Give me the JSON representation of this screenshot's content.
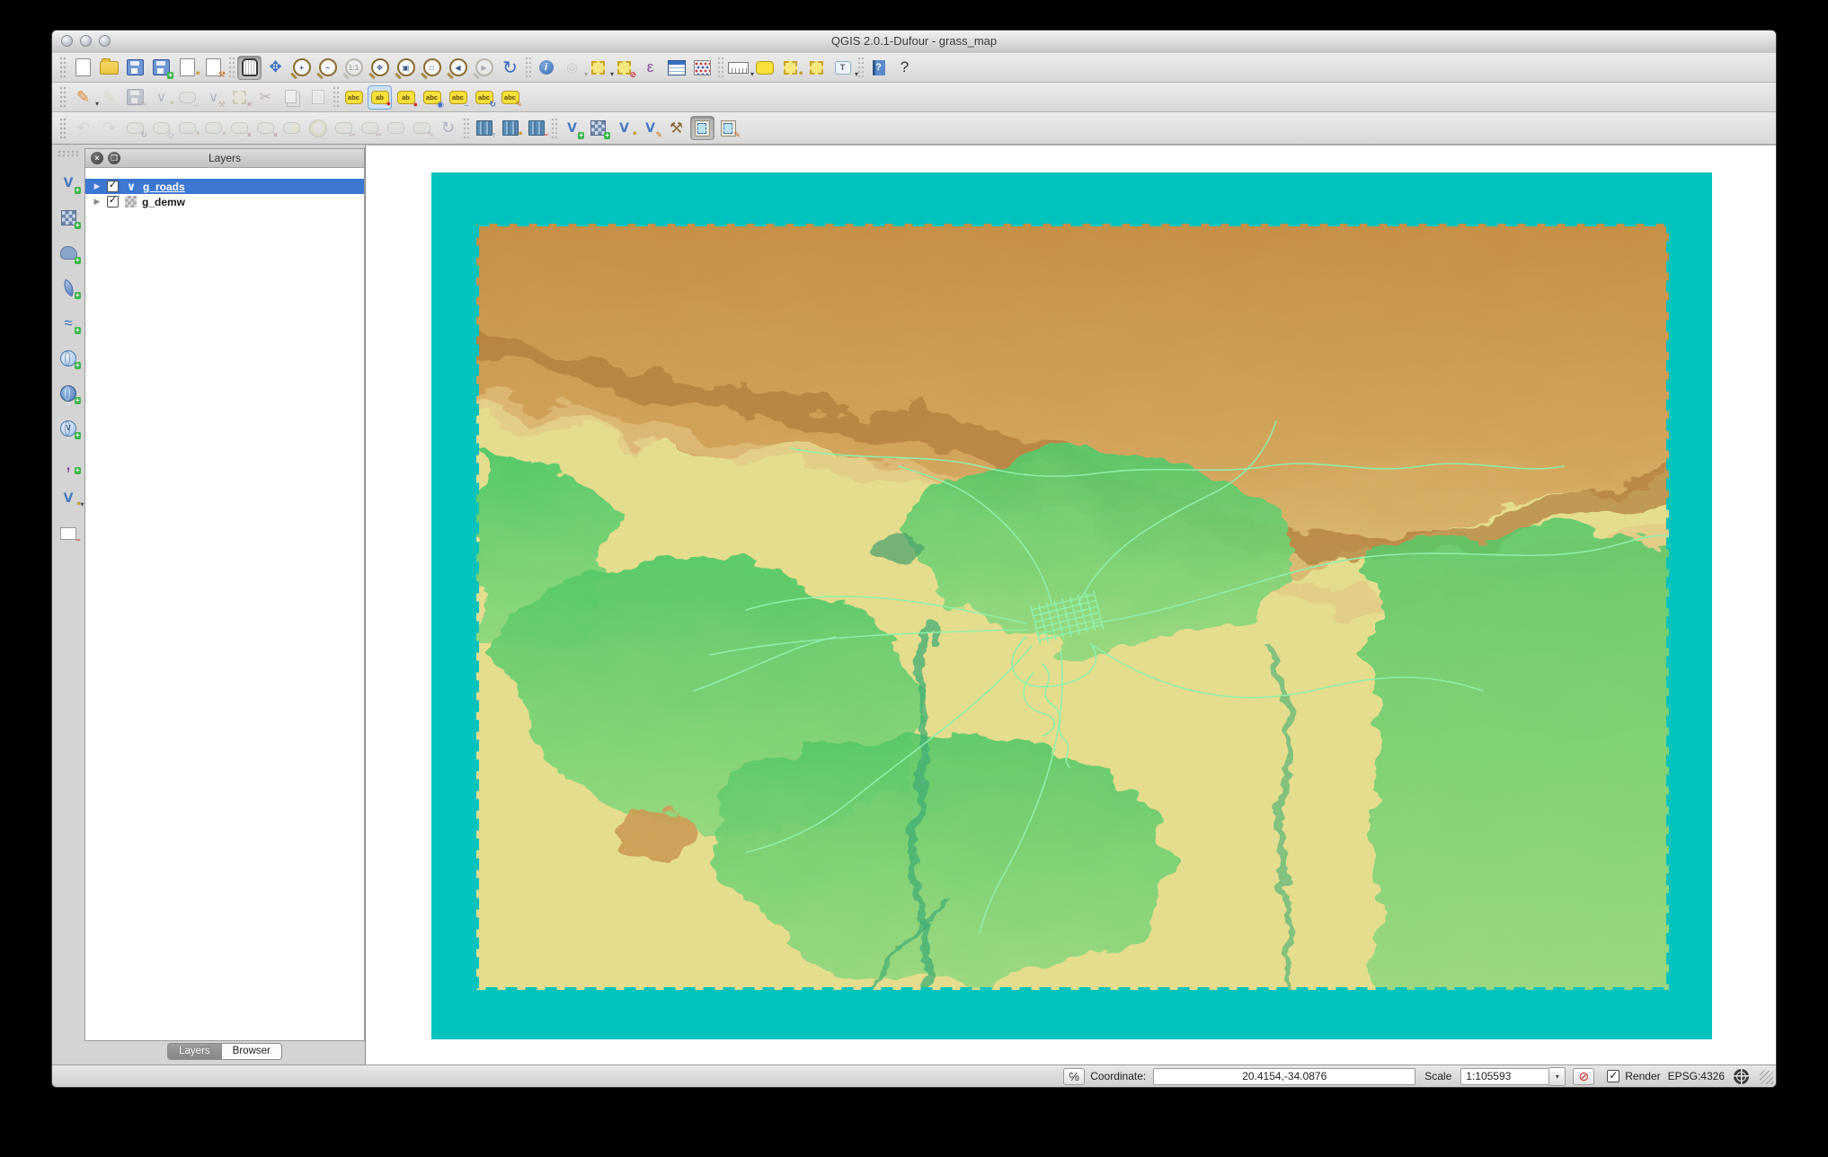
{
  "window": {
    "title": "QGIS 2.0.1-Dufour - grass_map"
  },
  "colors": {
    "teal": "#00c3be",
    "roads": "#8fefac",
    "selection": "#3b77d3"
  },
  "ui": {
    "dropdown_glyph": "▾",
    "expand_glyph": "▶",
    "check_glyph": "✓",
    "close_glyph": "×",
    "float_glyph": "❒",
    "vector_glyph": "∨",
    "coord_toggle_glyph": "℅",
    "stop_render_glyph": "⊘"
  },
  "toolbars": {
    "row1": [
      {
        "n": "new-project",
        "k": "page"
      },
      {
        "n": "open-project",
        "k": "folder"
      },
      {
        "n": "save-project",
        "k": "floppy"
      },
      {
        "n": "save-project-as",
        "k": "floppy",
        "b": "+",
        "bc": "g"
      },
      {
        "n": "new-print-composer",
        "k": "page",
        "b": "*",
        "bc": "y"
      },
      {
        "n": "composer-manager",
        "k": "page",
        "b": "⚒",
        "bc": "o"
      },
      {
        "sep": 1
      },
      {
        "n": "pan-map",
        "k": "hand",
        "s": "p"
      },
      {
        "n": "pan-to-selection",
        "g": "✥",
        "c": "c-blue",
        "fs": 17
      },
      {
        "n": "zoom-in",
        "k": "mag",
        "g": "+"
      },
      {
        "n": "zoom-out",
        "k": "mag",
        "g": "−"
      },
      {
        "n": "zoom-actual-size",
        "k": "mag",
        "g": "1:1",
        "s": "d"
      },
      {
        "n": "zoom-full-extent",
        "k": "mag",
        "g": "✥"
      },
      {
        "n": "zoom-to-selection",
        "k": "mag",
        "g": "▣"
      },
      {
        "n": "zoom-to-layer",
        "k": "mag",
        "g": "□"
      },
      {
        "n": "zoom-last",
        "k": "mag",
        "g": "◀"
      },
      {
        "n": "zoom-next",
        "k": "mag",
        "g": "▶",
        "s": "d"
      },
      {
        "n": "refresh-map",
        "g": "↻",
        "c": "c-blue",
        "fs": 20
      },
      {
        "sep": 1
      },
      {
        "n": "identify-features",
        "k": "info",
        "g": "i"
      },
      {
        "n": "run-feature-action",
        "g": "◎",
        "c": "c-gray",
        "s": "d",
        "dd": 1
      },
      {
        "n": "select-features",
        "k": "ysq",
        "dd": 1
      },
      {
        "n": "deselect-features",
        "k": "ysq",
        "b": "⊘",
        "bc": "r"
      },
      {
        "n": "select-by-expression",
        "g": "ε",
        "c": "c-purple",
        "fs": 17
      },
      {
        "n": "open-attribute-table",
        "k": "table"
      },
      {
        "n": "field-calculator",
        "k": "abacus"
      },
      {
        "sep": 1
      },
      {
        "n": "measure",
        "k": "ruler",
        "dd": 1
      },
      {
        "n": "map-tips",
        "k": "bubble"
      },
      {
        "n": "new-bookmark",
        "k": "ysq",
        "b": "*",
        "bc": "y"
      },
      {
        "n": "show-bookmarks",
        "k": "ysq"
      },
      {
        "n": "text-annotation",
        "k": "bubble-t",
        "g": "T",
        "dd": 1
      },
      {
        "sep": 1
      },
      {
        "n": "help-contents",
        "k": "book",
        "g": "?"
      },
      {
        "n": "whats-this",
        "g": "?",
        "c": "c-dark",
        "fs": 17
      }
    ],
    "row2": [
      {
        "n": "current-edits",
        "g": "✎",
        "c": "c-orange",
        "fs": 18,
        "dd": 1
      },
      {
        "n": "toggle-editing",
        "g": "✎",
        "c": "c-yellow",
        "fs": 18,
        "s": "d"
      },
      {
        "n": "save-layer-edits",
        "k": "floppy",
        "s": "d",
        "b": "✎",
        "bc": "o"
      },
      {
        "n": "add-feature",
        "g": "∨",
        "c": "c-blue",
        "fs": 15,
        "s": "d",
        "b": "*",
        "bc": "y"
      },
      {
        "n": "move-feature",
        "k": "blob",
        "s": "d",
        "b": "→",
        "bc": "b"
      },
      {
        "n": "node-tool",
        "g": "∨",
        "c": "c-blue",
        "fs": 15,
        "s": "d",
        "b": "⚒",
        "bc": "o"
      },
      {
        "n": "delete-selected",
        "k": "ysq",
        "s": "d",
        "b": "×",
        "bc": "r"
      },
      {
        "n": "cut-features",
        "g": "✂",
        "c": "c-red",
        "fs": 16,
        "s": "d"
      },
      {
        "n": "copy-features",
        "k": "copy",
        "s": "d"
      },
      {
        "n": "paste-features",
        "k": "paste",
        "s": "d"
      },
      {
        "sep": 1
      },
      {
        "n": "layer-labeling-options",
        "k": "bubble",
        "g": "abc"
      },
      {
        "n": "pin-unpin-labels",
        "k": "bubble",
        "g": "ab",
        "s": "hl",
        "b": "●",
        "bc": "r"
      },
      {
        "n": "highlight-pinned-labels",
        "k": "bubble",
        "g": "ab",
        "b": "●",
        "bc": "r"
      },
      {
        "n": "show-hide-labels",
        "k": "bubble",
        "g": "abc",
        "b": "◉",
        "bc": "b"
      },
      {
        "n": "move-label",
        "k": "bubble",
        "g": "abc",
        "b": "→",
        "bc": "b"
      },
      {
        "n": "rotate-label",
        "k": "bubble",
        "g": "abc",
        "b": "↻",
        "bc": "b"
      },
      {
        "n": "change-label",
        "k": "bubble",
        "g": "abc",
        "b": "✎",
        "bc": "o"
      }
    ],
    "row3": [
      {
        "n": "undo",
        "g": "↶",
        "c": "c-green",
        "fs": 18,
        "s": "d"
      },
      {
        "n": "redo",
        "g": "↷",
        "c": "c-green",
        "fs": 18,
        "s": "d"
      },
      {
        "n": "rotate-feature",
        "k": "blob",
        "b": "↻",
        "bc": "b",
        "s": "d"
      },
      {
        "n": "simplify-feature",
        "k": "blob",
        "b": "◇",
        "bc": "b",
        "s": "d"
      },
      {
        "n": "add-ring",
        "k": "blob",
        "b": "*",
        "bc": "y",
        "s": "d"
      },
      {
        "n": "add-part",
        "k": "blob",
        "b": "*",
        "bc": "y",
        "s": "d"
      },
      {
        "n": "delete-ring",
        "k": "blob",
        "b": "×",
        "bc": "r",
        "s": "d"
      },
      {
        "n": "delete-part",
        "k": "blob",
        "b": "×",
        "bc": "r",
        "s": "d"
      },
      {
        "n": "reshape-features",
        "k": "blob2",
        "s": "d"
      },
      {
        "n": "offset-curve",
        "k": "ring",
        "s": "d"
      },
      {
        "n": "split-features",
        "k": "blob",
        "b": "✂",
        "bc": "r",
        "s": "d"
      },
      {
        "n": "split-parts",
        "k": "blob",
        "b": "✂",
        "bc": "r",
        "s": "d"
      },
      {
        "n": "merge-features",
        "k": "blob",
        "s": "d"
      },
      {
        "n": "merge-feature-attributes",
        "k": "blob",
        "b": "✎",
        "bc": "o",
        "s": "d"
      },
      {
        "n": "rotate-point-symbols",
        "g": "↻",
        "c": "c-blue",
        "fs": 18,
        "s": "d"
      },
      {
        "sep": 1
      },
      {
        "n": "open-mapset",
        "k": "books",
        "b": "↑",
        "bc": "b"
      },
      {
        "n": "new-mapset",
        "k": "books",
        "b": "*",
        "bc": "y"
      },
      {
        "n": "close-mapset",
        "k": "books",
        "b": "−",
        "bc": "r"
      },
      {
        "sep": 1
      },
      {
        "n": "add-grass-vector-layer",
        "k": "vplus",
        "g": "V",
        "b": "+",
        "bc": "g"
      },
      {
        "n": "add-grass-raster-layer",
        "k": "raster",
        "b": "+",
        "bc": "g"
      },
      {
        "n": "create-new-grass-vector",
        "k": "vplus",
        "g": "V",
        "b": "*",
        "bc": "y"
      },
      {
        "n": "edit-grass-vector",
        "k": "vplus",
        "g": "V",
        "b": "✎",
        "bc": "o"
      },
      {
        "n": "open-grass-tools",
        "g": "⚒",
        "c": "c-brown",
        "fs": 17
      },
      {
        "n": "display-current-grass-region",
        "k": "scroll",
        "s": "p"
      },
      {
        "n": "edit-current-grass-region",
        "k": "scroll",
        "b": "✎",
        "bc": "o"
      }
    ],
    "left": [
      {
        "n": "add-vector-layer",
        "k": "vplus",
        "g": "V",
        "b": "+",
        "bc": "g"
      },
      {
        "n": "add-raster-layer",
        "k": "raster",
        "b": "+",
        "bc": "g"
      },
      {
        "n": "add-postgis-layer",
        "k": "eleph",
        "b": "+",
        "bc": "g"
      },
      {
        "n": "add-spatialite-layer",
        "k": "feather",
        "b": "+",
        "bc": "g"
      },
      {
        "n": "add-mssql-layer",
        "g": "≈",
        "c": "c-blue",
        "fs": 17,
        "b": "+",
        "bc": "g"
      },
      {
        "n": "add-wms-layer",
        "k": "globe",
        "b": "+",
        "bc": "g"
      },
      {
        "n": "add-wcs-layer",
        "k": "globe2",
        "b": "+",
        "bc": "g"
      },
      {
        "n": "add-wfs-layer",
        "k": "globe",
        "g": "V",
        "b": "+",
        "bc": "g"
      },
      {
        "n": "add-delimited-text-layer",
        "g": ",",
        "c": "c-purple",
        "fs": 24,
        "b": "+",
        "bc": "g"
      },
      {
        "n": "new-shapefile-layer",
        "k": "vplus",
        "g": "V",
        "b": "*",
        "bc": "y",
        "dd": 1
      },
      {
        "n": "remove-layer",
        "k": "wrect",
        "b": "−",
        "bc": "r"
      }
    ]
  },
  "layers_panel": {
    "title": "Layers",
    "layers": [
      {
        "name": "g_roads",
        "type": "vector",
        "checked": true,
        "selected": true
      },
      {
        "name": "g_demw",
        "type": "raster",
        "checked": true,
        "selected": false
      }
    ],
    "tabs": [
      {
        "label": "Layers",
        "active": true
      },
      {
        "label": "Browser",
        "active": false
      }
    ]
  },
  "status_bar": {
    "coordinate_label": "Coordinate:",
    "coordinate_value": "20.4154,-34.0876",
    "scale_label": "Scale",
    "scale_value": "1:105593",
    "render_label": "Render",
    "render_checked": true,
    "crs": "EPSG:4326"
  }
}
